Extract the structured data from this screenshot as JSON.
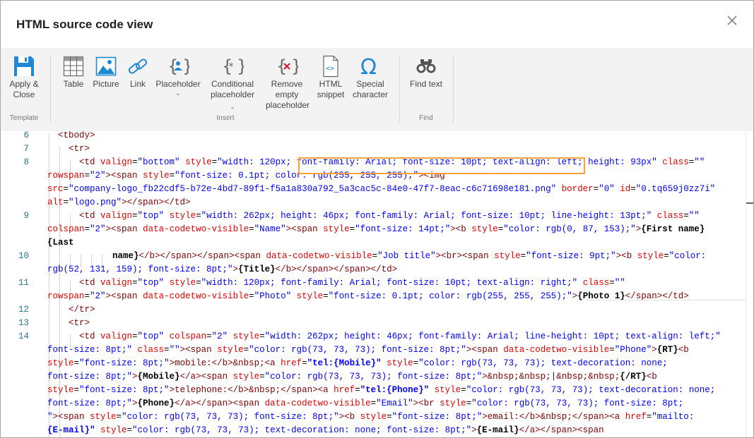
{
  "dialog": {
    "title": "HTML source code view"
  },
  "ribbon": {
    "groups": {
      "template": "Template",
      "insert": "Insert",
      "find": "Find"
    },
    "buttons": {
      "apply_close": "Apply & Close",
      "table": "Table",
      "picture": "Picture",
      "link": "Link",
      "placeholder": "Placeholder",
      "conditional_placeholder": "Conditional placeholder",
      "remove_empty_placeholder": "Remove empty placeholder",
      "html_snippet": "HTML snippet",
      "special_character": "Special character",
      "find_text": "Find text"
    }
  },
  "editor": {
    "line_numbers": [
      "6",
      "7",
      "8",
      "9",
      "10",
      "11",
      "12",
      "13",
      "14"
    ],
    "colors": {
      "tag": "#800000",
      "attribute": "#e50000",
      "value": "#0000ff",
      "line_number": "#237893",
      "highlight_border": "#f5a33a"
    },
    "rows": [
      [
        "<tbody>"
      ],
      [
        "<tr>"
      ],
      [
        "<td",
        " valign",
        "=",
        "\"bottom\"",
        " style",
        "=",
        "\"width: 120px; font-family: Arial; font-size: 10pt; text-align: left; height: 93px\"",
        " class",
        "=",
        "\"\""
      ],
      [
        "rowspan",
        "=",
        "\"2\"",
        "><span",
        " style",
        "=",
        "\"font-size: 0.1pt; color: rgb(255, 255, 255);\"",
        "><img"
      ],
      [
        "src",
        "=",
        "\"company-logo_fb22cdf5-b72e-4bd7-89f1-f5a1a830a792_5a3cac5c-84e0-47f7-8eac-c6c71698e181.png\"",
        " border",
        "=",
        "\"0\"",
        " id",
        "=",
        "\"0.tq659j0zz7i\""
      ],
      [
        "alt",
        "=",
        "\"logo.png\"",
        "></span></td>"
      ],
      [
        "<td",
        " valign",
        "=",
        "\"top\"",
        " style",
        "=",
        "\"width: 262px; height: 46px; font-family: Arial; font-size: 10pt; line-height: 13pt;\"",
        " class",
        "=",
        "\"\""
      ],
      [
        "colspan",
        "=",
        "\"2\"",
        "><span",
        " data-codetwo-visible",
        "=",
        "\"Name\"",
        "><span",
        " style",
        "=",
        "\"font-size: 14pt;\"",
        "><b",
        " style",
        "=",
        "\"color: rgb(0, 87, 153);\"",
        ">",
        "{First name}"
      ],
      [
        "{Last"
      ],
      [
        "name}",
        "</b></span></span><span",
        " data-codetwo-visible",
        "=",
        "\"Job title\"",
        "><br><span",
        " style",
        "=",
        "\"font-size: 9pt;\"",
        "><b",
        " style",
        "=",
        "\"color:"
      ],
      [
        "rgb(52, 131, 159); font-size: 8pt;\"",
        ">",
        "{Title}",
        "</b></span></span></td>"
      ],
      [
        "<td",
        " valign",
        "=",
        "\"top\"",
        " style",
        "=",
        "\"width: 120px; font-family: Arial; font-size: 10pt; text-align: right;\"",
        " class",
        "=",
        "\"\""
      ],
      [
        "rowspan",
        "=",
        "\"2\"",
        "><span",
        " data-codetwo-visible",
        "=",
        "\"Photo\"",
        " style",
        "=",
        "\"font-size: 0.1pt; color: rgb(255, 255, 255);\"",
        ">",
        "{Photo 1}",
        "</span></td>"
      ],
      [
        "</tr>"
      ],
      [
        "<tr>"
      ],
      [
        "<td",
        " valign",
        "=",
        "\"top\"",
        " colspan",
        "=",
        "\"2\"",
        " style",
        "=",
        "\"width: 262px; height: 46px; font-family: Arial; line-height: 10pt; text-align: left;\""
      ],
      [
        "font-size: 8pt;\"",
        " class",
        "=",
        "\"\"",
        "><span",
        " style",
        "=",
        "\"color: rgb(73, 73, 73); font-size: 8pt;\"",
        "><span",
        " data-codetwo-visible",
        "=",
        "\"Phone\"",
        ">",
        "{RT}",
        "<b"
      ],
      [
        "style",
        "=",
        "\"font-size: 8pt;\"",
        ">mobile:</b>&nbsp;<a",
        " href",
        "=",
        "\"tel:{Mobile}\"",
        " style",
        "=",
        "\"color: rgb(73, 73, 73); text-decoration: none;"
      ],
      [
        "font-size: 8pt;\"",
        ">",
        "{Mobile}",
        "</a><span",
        " style",
        "=",
        "\"color: rgb(73, 73, 73); font-size: 8pt;\"",
        ">&nbsp;&nbsp;|&nbsp;&nbsp;",
        "{/RT}",
        "<b"
      ],
      [
        "style",
        "=",
        "\"font-size: 8pt;\"",
        ">telephone:</b>&nbsp;</span><a",
        " href",
        "=",
        "\"tel:{Phone}\"",
        " style",
        "=",
        "\"color: rgb(73, 73, 73); text-decoration: none;"
      ],
      [
        "font-size: 8pt;\"",
        ">",
        "{Phone}",
        "</a></span><span",
        " data-codetwo-visible",
        "=",
        "\"Email\"",
        "><br",
        " style",
        "=",
        "\"color: rgb(73, 73, 73); font-size: 8pt;"
      ],
      [
        "\"",
        "><span",
        " style",
        "=",
        "\"color: rgb(73, 73, 73); font-size: 8pt;\"",
        "><b",
        " style",
        "=",
        "\"font-size: 8pt;\"",
        ">email:</b>&nbsp;</span><a",
        " href",
        "=",
        "\"mailto:"
      ],
      [
        "{E-mail}\"",
        " style",
        "=",
        "\"color: rgb(73, 73, 73); text-decoration: none; font-size: 8pt;\"",
        ">",
        "{E-mail}",
        "</a></span><span"
      ]
    ]
  }
}
